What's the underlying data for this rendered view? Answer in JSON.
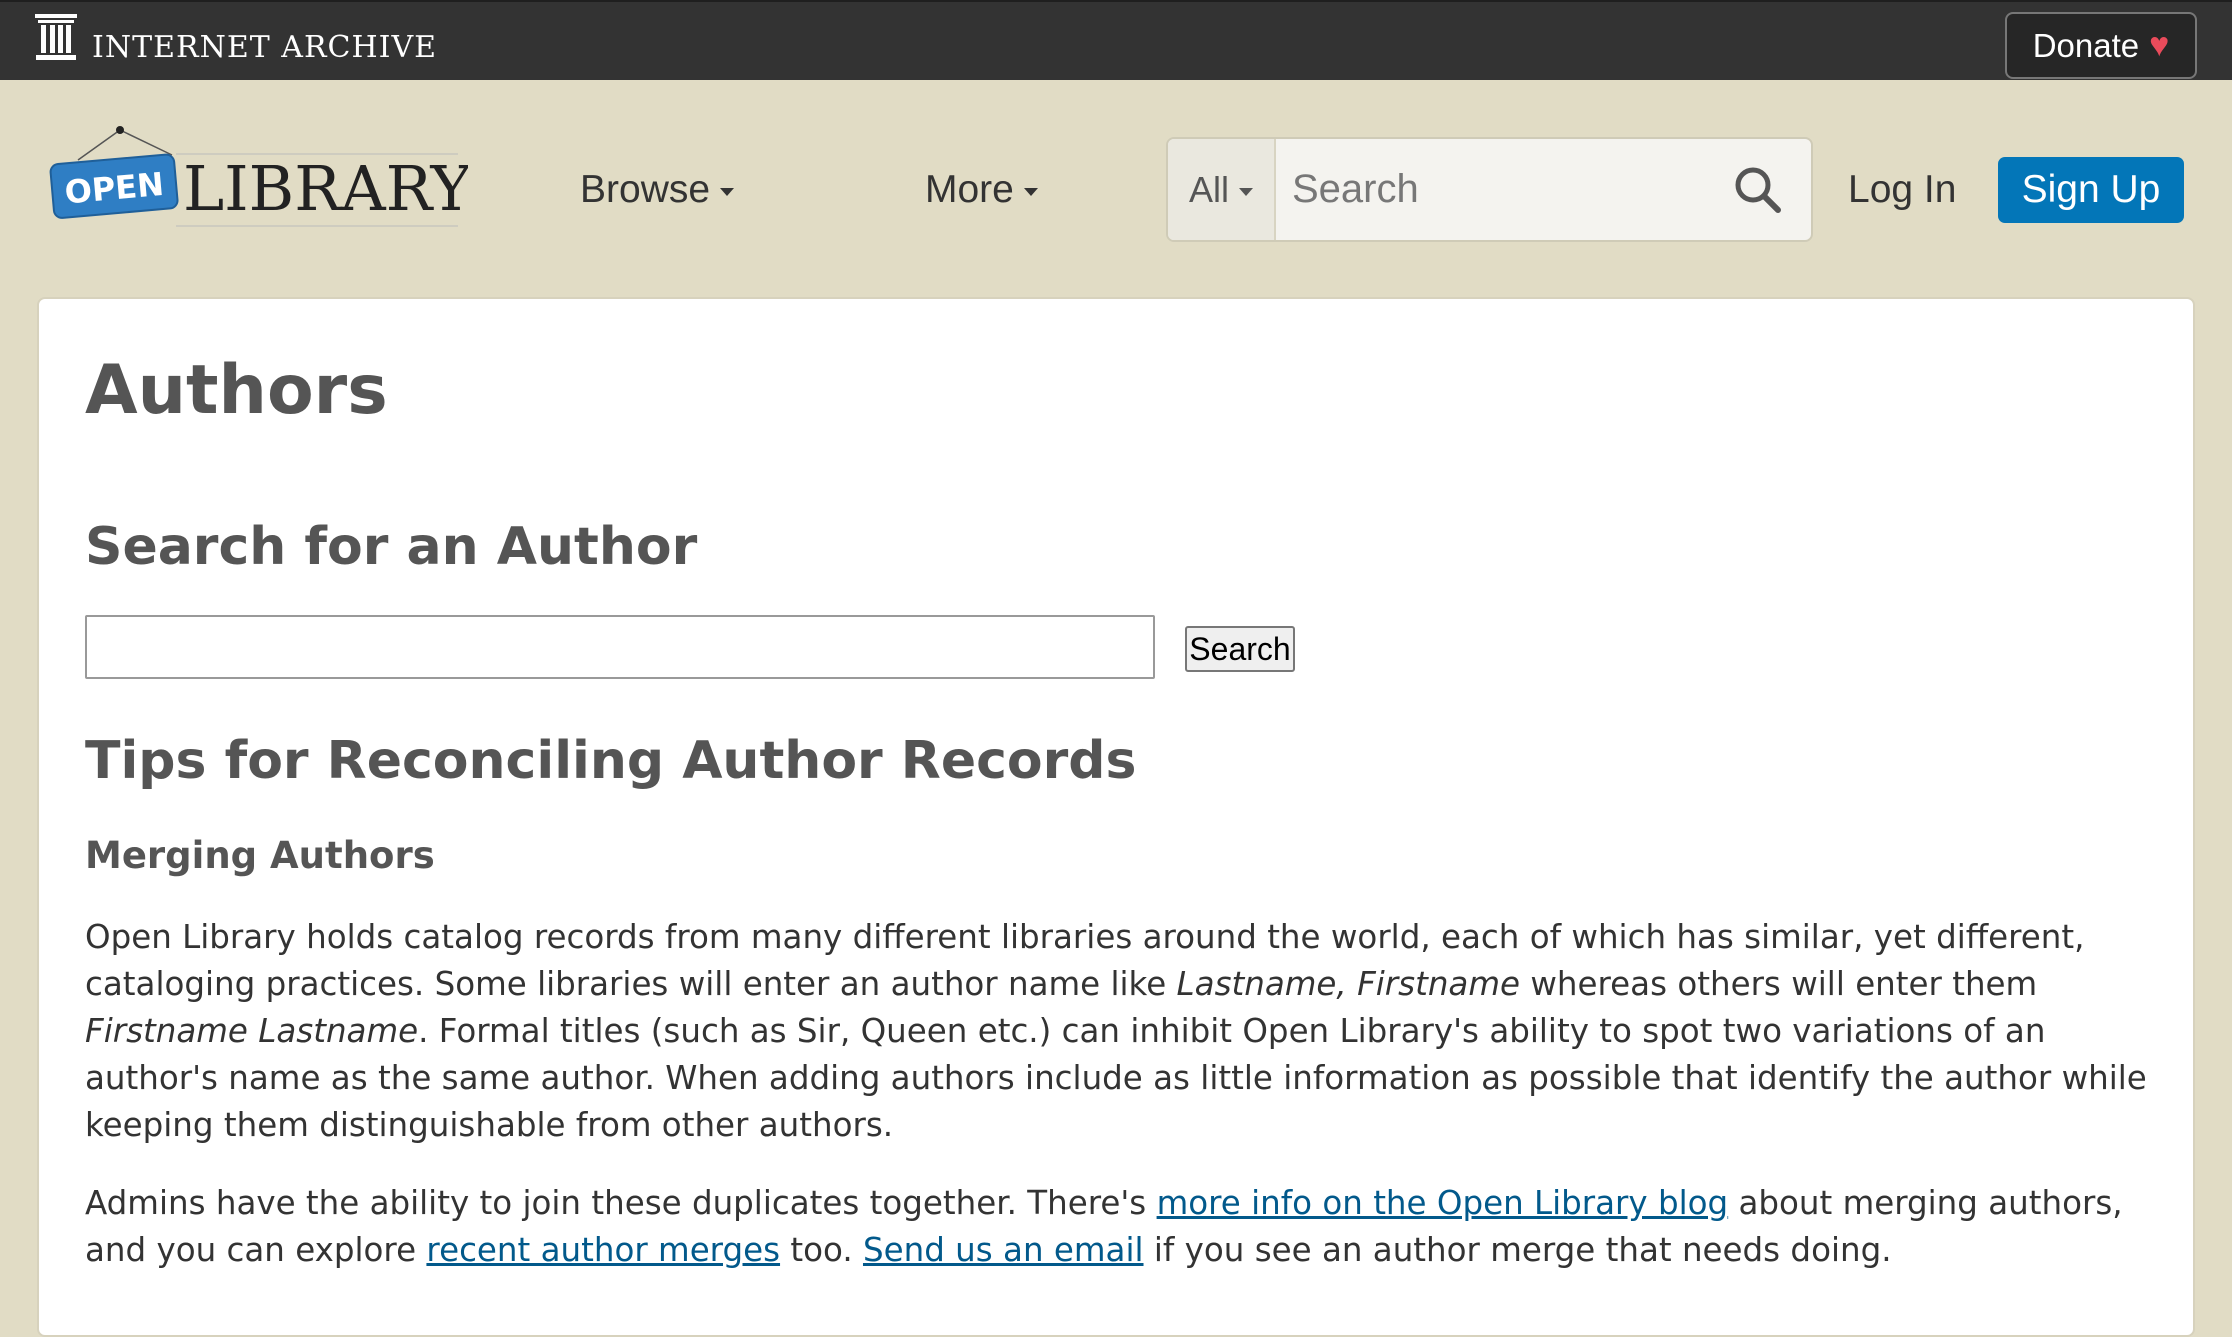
{
  "ia_bar": {
    "title": "INTERNET ARCHIVE",
    "donate_label": "Donate",
    "donate_icon": "heart-icon",
    "heart_glyph": "♥"
  },
  "header": {
    "logo_open": "OPEN",
    "logo_library": "LIBRARY",
    "browse_label": "Browse",
    "more_label": "More",
    "search_scope": "All",
    "search_placeholder": "Search",
    "login_label": "Log In",
    "signup_label": "Sign Up"
  },
  "colors": {
    "ia_bar_bg": "#333333",
    "page_bg": "#e1dcc5",
    "brand_blue": "#0376b8",
    "link": "#02598b",
    "heart": "#ea4b5b"
  },
  "main": {
    "title": "Authors",
    "search_heading": "Search for an Author",
    "author_search_value": "",
    "author_search_button": "Search",
    "tips_heading": "Tips for Reconciling Author Records",
    "merge_heading": "Merging Authors",
    "para1": {
      "t1": "Open Library holds catalog records from many different libraries around the world, each of which has similar, yet different, cataloging practices. Some libraries will enter an author name like ",
      "em1": "Lastname, Firstname",
      "t2": " whereas others will enter them ",
      "em2": "Firstname Lastname",
      "t3": ". Formal titles (such as Sir, Queen etc.) can inhibit Open Library's ability to spot two variations of an author's name as the same author. When adding authors include as little information as possible that identify the author while keeping them distinguishable from other authors."
    },
    "para2": {
      "t1": "Admins have the ability to join these duplicates together. There's ",
      "link1": "more info on the Open Library blog",
      "t2": " about merging authors, and you can explore ",
      "link2": "recent author merges",
      "t3": " too. ",
      "link3": "Send us an email",
      "t4": " if you see an author merge that needs doing."
    }
  }
}
